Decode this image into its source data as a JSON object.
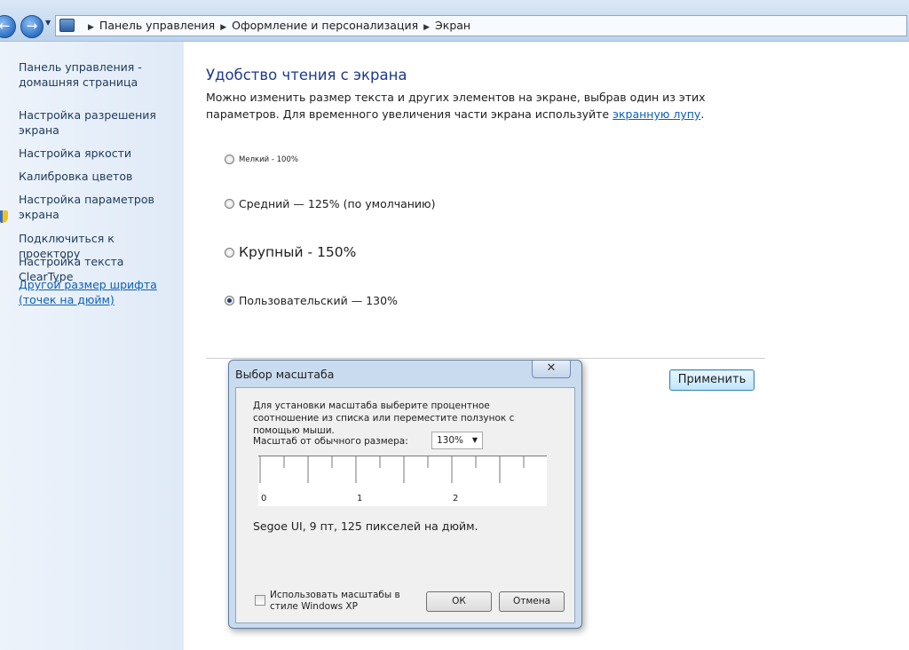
{
  "address_bar": {
    "crumbs": [
      "Панель управления",
      "Оформление и персонализация",
      "Экран"
    ]
  },
  "sidebar": {
    "items": [
      {
        "label": "Панель управления - домашняя страница"
      },
      {
        "label": "Настройка разрешения экрана"
      },
      {
        "label": "Настройка яркости"
      },
      {
        "label": "Калибровка цветов"
      },
      {
        "label": "Настройка параметров экрана"
      },
      {
        "label": "Подключиться к проектору"
      },
      {
        "label": "Настройка текста ClearType"
      },
      {
        "label": "Другой размер шрифта (точек на дюйм)"
      }
    ]
  },
  "main": {
    "heading": "Удобство чтения с экрана",
    "intro_text": "Можно изменить размер текста и других элементов на экране, выбрав один из этих параметров. Для временного увеличения части экрана используйте",
    "intro_link": "экранную лупу",
    "intro_end": ".",
    "options": [
      {
        "label": "Мелкий - 100%",
        "checked": false
      },
      {
        "label": "Средний — 125% (по умолчанию)",
        "checked": false
      },
      {
        "label": "Крупный - 150%",
        "checked": false
      },
      {
        "label": "Пользовательский — 130%",
        "checked": true
      }
    ],
    "apply_label": "Применить"
  },
  "dialog": {
    "title": "Выбор масштаба",
    "close_glyph": "✕",
    "instructions": "Для установки масштаба выберите процентное соотношение из списка или переместите ползунок с помощью мыши.",
    "scale_label": "Масштаб от обычного размера:",
    "scale_value": "130%",
    "ruler_labels": [
      "0",
      "1",
      "2"
    ],
    "font_info": "Segoe UI, 9 пт, 125 пикселей на дюйм.",
    "xp_checkbox_label": "Использовать масштабы в стиле Windows XP",
    "xp_checked": false,
    "ok_label": "ОК",
    "cancel_label": "Отмена"
  }
}
